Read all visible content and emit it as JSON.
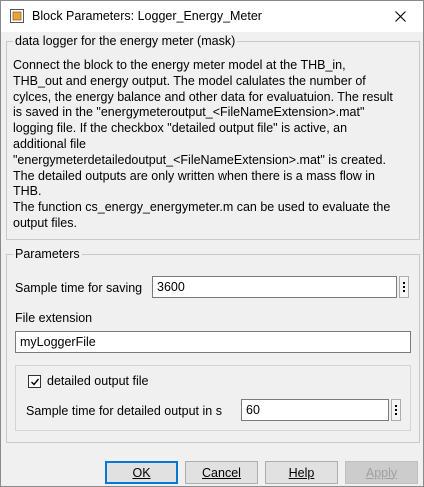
{
  "window": {
    "title": "Block Parameters: Logger_Energy_Meter"
  },
  "mask": {
    "legend": "data logger for the energy meter (mask)",
    "description_lines": [
      "Connect the block to the energy meter model at the THB_in,",
      "THB_out and energy output. The model calulates the number of",
      "cylces, the energy balance and other data for evaluatuion. The result",
      "is saved in the \"energymeteroutput_<FileNameExtension>.mat\"",
      "logging file. If the checkbox \"detailed output file\" is active, an",
      "additional file",
      "\"energymeterdetailedoutput_<FileNameExtension>.mat\" is created.",
      "The detailed outputs are only written when there is a mass flow in",
      "THB.",
      "The function cs_energy_energymeter.m can be used to evaluate the",
      "output files."
    ]
  },
  "params": {
    "legend": "Parameters",
    "sample_time_label": "Sample time for saving",
    "sample_time_value": "3600",
    "file_ext_label": "File extension",
    "file_ext_value": "myLoggerFile",
    "detailed_checkbox_label": "detailed output file",
    "detailed_checked": true,
    "detailed_sample_label": "Sample time for detailed output in s",
    "detailed_sample_value": "60"
  },
  "buttons": {
    "ok": "OK",
    "cancel": "Cancel",
    "help": "Help",
    "apply": "Apply"
  },
  "icons": {
    "app": "simulink-block-icon",
    "close": "close-icon",
    "menu": "vertical-ellipsis-icon",
    "check": "checkmark-icon"
  },
  "colors": {
    "default_button_border": "#0078d7",
    "disabled_text": "#a0a0a0"
  }
}
